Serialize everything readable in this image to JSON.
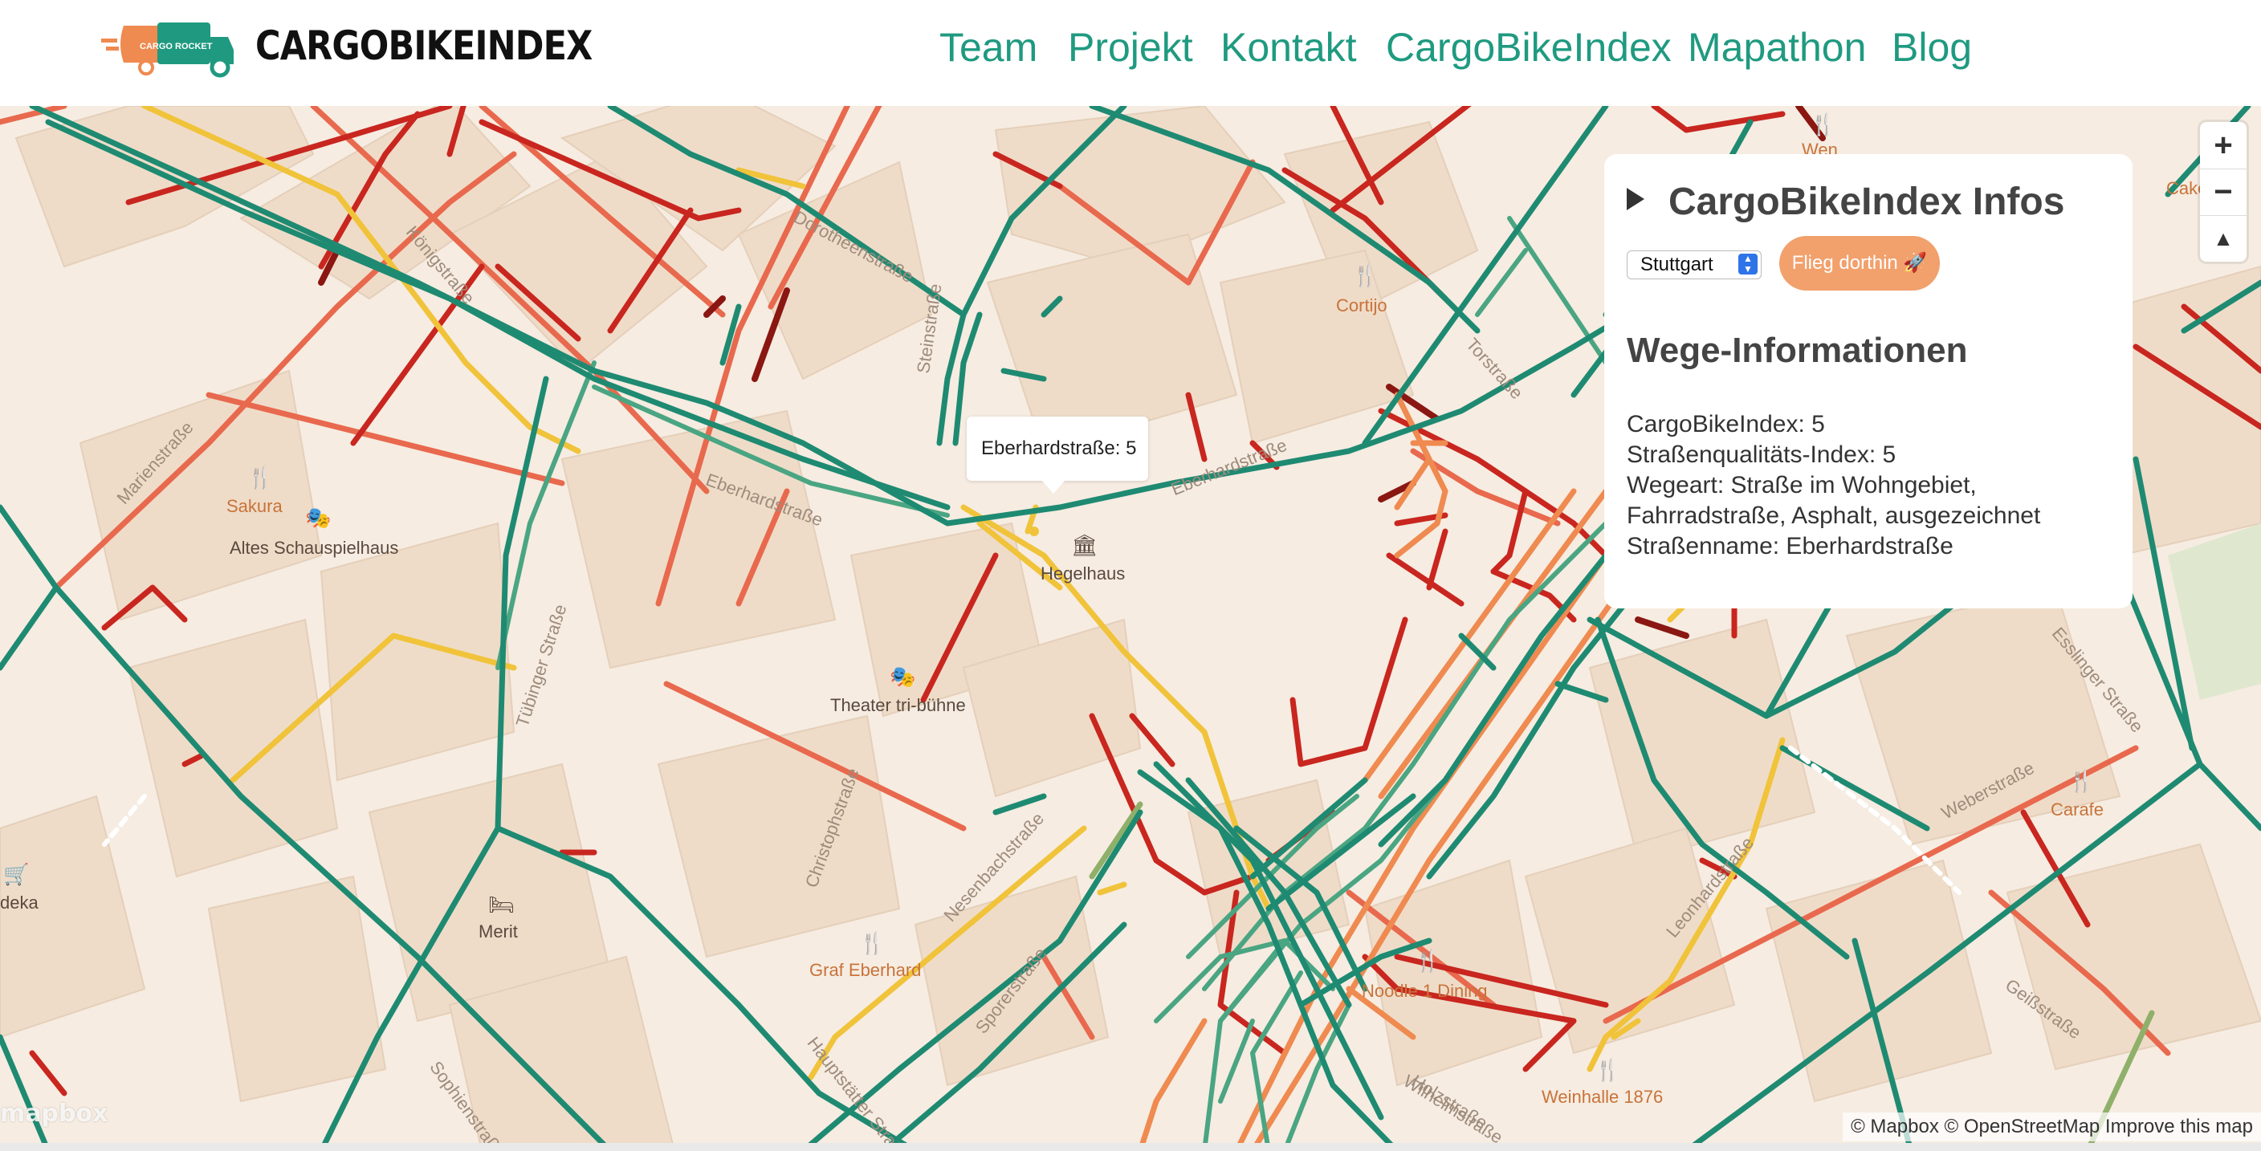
{
  "header": {
    "logo_text": "CARGO ROCKET",
    "brand": "CARGOBIKEINDEX",
    "nav": [
      "Team",
      "Projekt",
      "Kontakt",
      "CargoBikeIndex",
      "Mapathon",
      "Blog"
    ]
  },
  "map": {
    "places": [
      {
        "name": "Sakura",
        "kind": "restaurant"
      },
      {
        "name": "Altes Schauspielhaus",
        "kind": "theater"
      },
      {
        "name": "Cortijo",
        "kind": "restaurant"
      },
      {
        "name": "Hegelhaus",
        "kind": "museum"
      },
      {
        "name": "Theater tri-bühne",
        "kind": "theater"
      },
      {
        "name": "Merit",
        "kind": "hotel"
      },
      {
        "name": "Graf Eberhard",
        "kind": "restaurant"
      },
      {
        "name": "Noodle 1 Dining",
        "kind": "restaurant"
      },
      {
        "name": "Weinhalle 1876",
        "kind": "restaurant"
      },
      {
        "name": "Carafe",
        "kind": "restaurant"
      },
      {
        "name": "deka",
        "kind": "shop"
      },
      {
        "name": "Cakeshi",
        "kind": "cafe"
      },
      {
        "name": "Wen",
        "kind": "restaurant"
      }
    ],
    "streets": [
      "Marienstraße",
      "Königstraße",
      "Dorotheenstraße",
      "Eberhardstraße",
      "Eberhardstraße",
      "Tübinger Straße",
      "Steinstraße",
      "Nesenbachstraße",
      "Sporerstraße",
      "Hauptstätter Straße",
      "Torstraße",
      "Holzstraße",
      "Leonhardstraße",
      "Weberstraße",
      "Wilhelmstraße",
      "Esslinger Straße",
      "Christophstraße",
      "Sophienstraße",
      "Geißstraße"
    ],
    "popup": "Eberhardstraße: 5",
    "zoom_in": "+",
    "zoom_out": "−",
    "compass": "▲",
    "mapbox_logo": "mapbox",
    "attribution": "© Mapbox © OpenStreetMap Improve this map",
    "colors": {
      "background": "#f6ece1",
      "block": "#efdcc8",
      "green": "#1f8a72",
      "lightgreen": "#4aa582",
      "olive": "#8fb06a",
      "yellow": "#f0c33a",
      "orange": "#ef8a50",
      "salmon": "#e8694e",
      "red": "#c8261f",
      "darkred": "#8a1712"
    }
  },
  "panel": {
    "title": "CargoBikeIndex Infos",
    "city": "Stuttgart",
    "fly_button": "Flieg dorthin 🚀",
    "section_title": "Wege-Informationen",
    "info": [
      "CargoBikeIndex: 5",
      "Straßenqualitäts-Index: 5",
      "Wegeart: Straße im Wohngebiet,",
      "Fahrradstraße, Asphalt, ausgezeichnet",
      "Straßenname: Eberhardstraße"
    ]
  }
}
